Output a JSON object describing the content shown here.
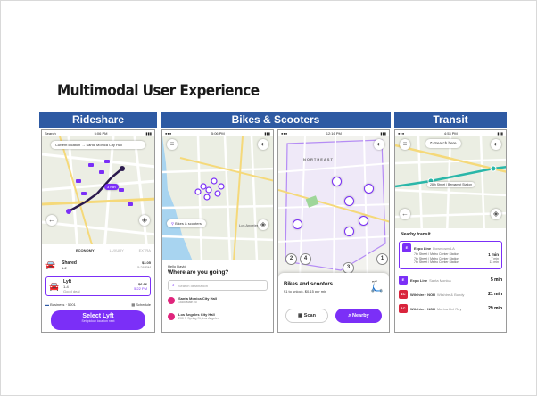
{
  "slide": {
    "title": "Multimodal User Experience"
  },
  "sections": {
    "rideshare": "Rideshare",
    "bikes": "Bikes & Scooters",
    "transit": "Transit"
  },
  "rideshare": {
    "status_left": "Search",
    "status_time": "5:06 PM",
    "location_bar": "Current location → Santa Monica City Hall",
    "eta_badge": "3 min",
    "tabs": [
      "ECONOMY",
      "LUXURY",
      "EXTRA"
    ],
    "options": [
      {
        "name": "Shared",
        "sub": "1-2",
        "price": "$3.05",
        "time": "5:26 PM"
      },
      {
        "name": "Lyft",
        "sub": "1-4",
        "note": "Good deal",
        "price": "$6.66",
        "time": "5:22 PM"
      }
    ],
    "payment": "Business · 5001",
    "schedule": "Schedule",
    "cta": "Select Lyft",
    "cta_sub": "Set pickup location next"
  },
  "bikes_home": {
    "status_time": "5:06 PM",
    "chip": "Bikes & scooters",
    "map_label": "Los Angeles",
    "greeting": "Hello David",
    "prompt": "Where are you going?",
    "search_placeholder": "Search destination",
    "places": [
      {
        "name": "Santa Monica City Hall",
        "addr": "1685 Main St"
      },
      {
        "name": "Los Angeles City Hall",
        "addr": "200 N Spring St, Los Angeles"
      }
    ]
  },
  "bikes_map": {
    "status_time": "12:16 PM",
    "area": "NORTHEAST",
    "pins": [
      "4",
      "2",
      "3",
      "1"
    ],
    "card_title": "Bikes and scooters",
    "card_sub": "$1 to unlock, $0.15 per min",
    "scan": "Scan",
    "nearby": "Nearby"
  },
  "transit": {
    "status_time": "4:53 PM",
    "search_here": "Search here",
    "station": "28th Street / Bergamot Station",
    "header": "Nearby transit",
    "lines": [
      {
        "badge": "E",
        "color": "#7b2ff7",
        "name": "Expo Line",
        "dest": "Downtown LA",
        "time": "1 min",
        "stops": [
          "7th Street / Metro Center Station",
          "7th Street / Metro Center Station",
          "7th Street / Metro Center Station"
        ],
        "times": [
          "1 min",
          "7 min",
          "13 min"
        ]
      },
      {
        "badge": "E",
        "color": "#7b2ff7",
        "name": "Expo Line",
        "dest": "Santa Monica",
        "time": "5 min"
      },
      {
        "badge": "1C",
        "color": "#d9243c",
        "name": "Wilshire · NOR",
        "dest": "Wilshire & Bundy",
        "time": "21 min"
      },
      {
        "badge": "1C",
        "color": "#d9243c",
        "name": "Wilshire · NOR",
        "dest": "Marina Del Rey",
        "time": "29 min"
      }
    ],
    "colors": {
      "brand": "#7b2ff7",
      "rapid": "#d9243c"
    }
  }
}
